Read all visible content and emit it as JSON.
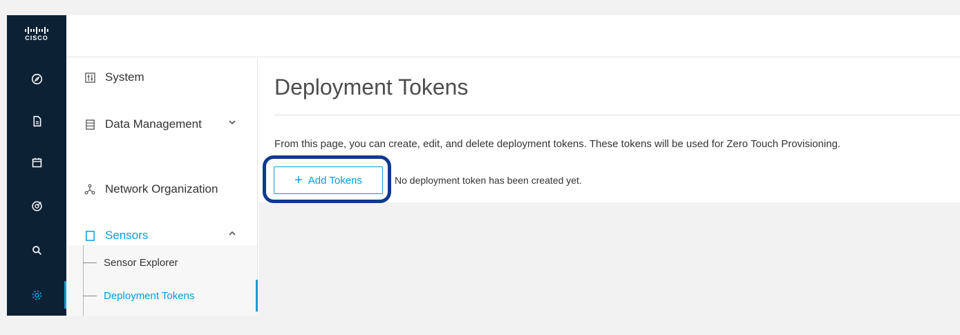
{
  "brand": {
    "logo_text": "CISCO"
  },
  "rail": {
    "items": [
      {
        "icon": "compass-icon"
      },
      {
        "icon": "document-icon"
      },
      {
        "icon": "calendar-icon"
      },
      {
        "icon": "target-icon"
      },
      {
        "icon": "search-icon"
      },
      {
        "icon": "gear-icon",
        "active": true
      }
    ]
  },
  "sidenav": {
    "items": [
      {
        "label": "System",
        "icon": "sliders-icon"
      },
      {
        "label": "Data Management",
        "icon": "database-icon",
        "expand": "chevron-down-icon"
      },
      {
        "label": "Network Organization",
        "icon": "network-icon"
      },
      {
        "label": "Sensors",
        "icon": "tablet-icon",
        "expand": "chevron-up-icon",
        "selected": true
      }
    ],
    "sub_items": [
      {
        "label": "Sensor Explorer"
      },
      {
        "label": "Deployment Tokens",
        "selected": true
      }
    ]
  },
  "main": {
    "title": "Deployment Tokens",
    "description": "From this page, you can create, edit, and delete deployment tokens. These tokens will be used for Zero Touch Provisioning.",
    "add_button_label": "Add Tokens",
    "empty_message": "No deployment token has been created yet."
  },
  "colors": {
    "accent": "#049fd9",
    "rail": "#0d2135",
    "highlight": "#0f3a8d"
  }
}
